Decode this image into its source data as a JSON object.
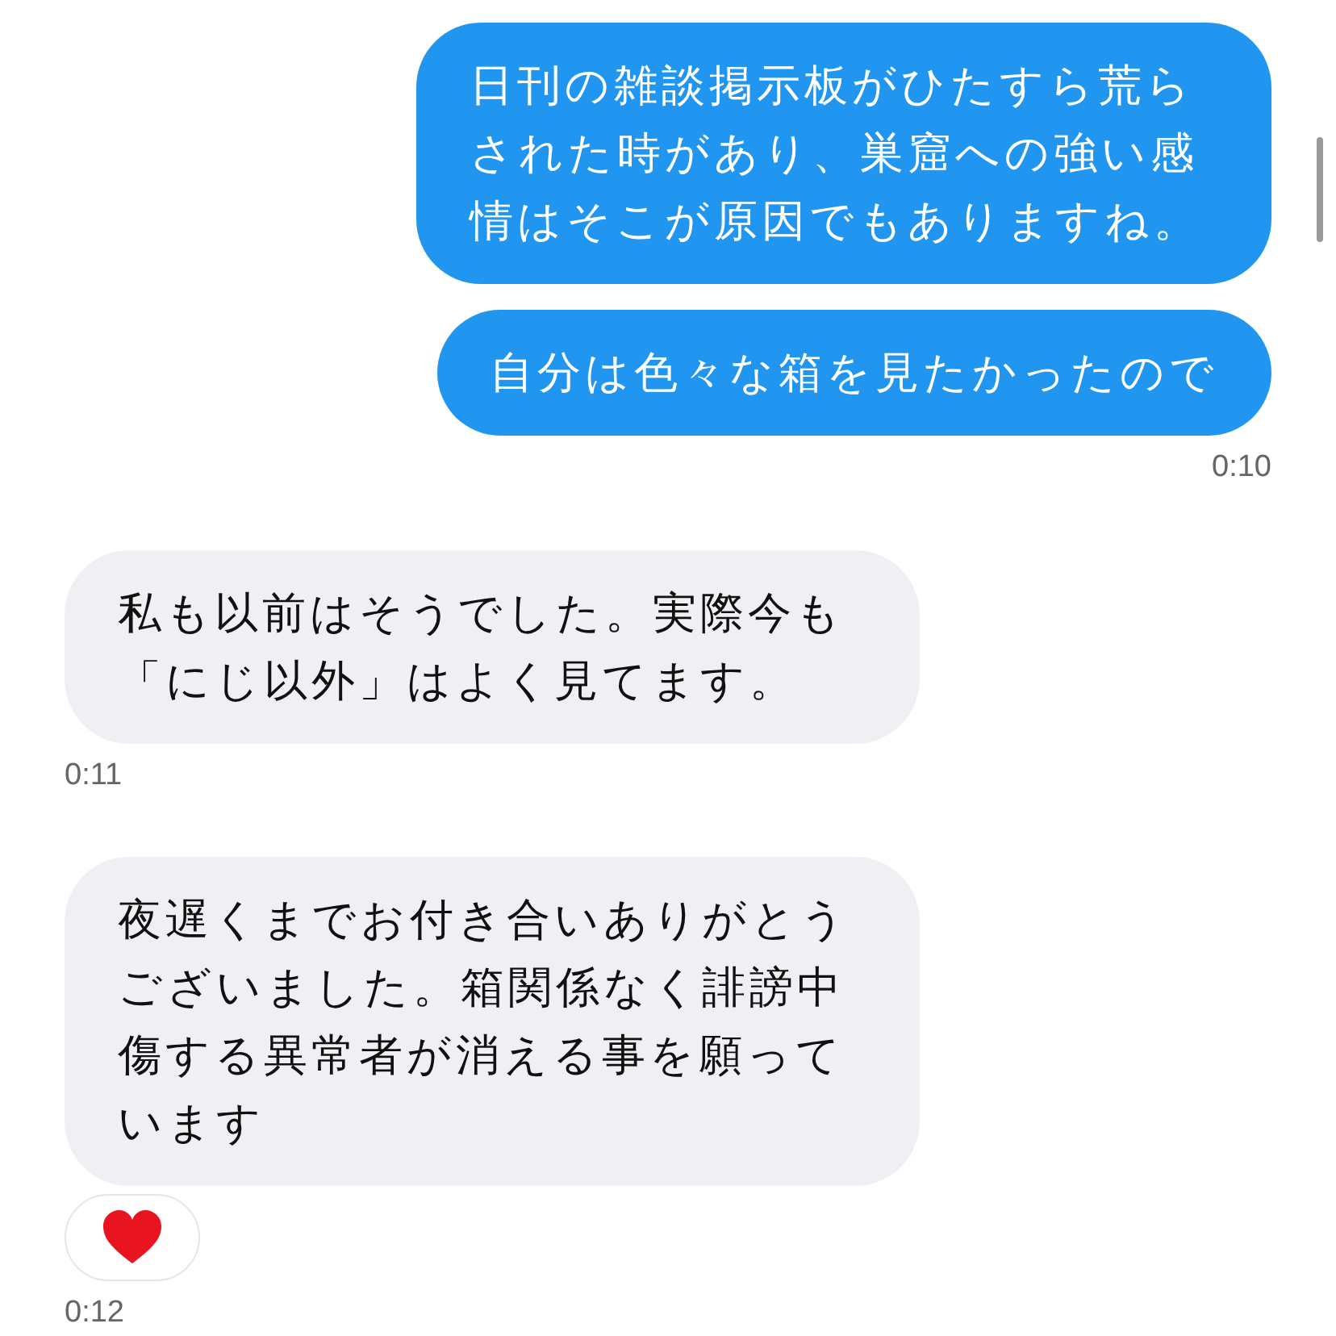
{
  "messages": [
    {
      "kind": "outgoing",
      "text": "日刊の雑談掲示板がひたすら荒らされた時があり、巣窟への強い感情はそこが原因でもありますね。",
      "reacted": false
    },
    {
      "kind": "outgoing",
      "text": "自分は色々な箱を見たかったので",
      "time": "0:10",
      "reacted": false
    },
    {
      "kind": "incoming",
      "text": "私も以前はそうでした。実際今も「にじ以外」はよく見てます。",
      "time": "0:11",
      "reacted": false
    },
    {
      "kind": "incoming",
      "text": "夜遅くまでお付き合いありがとうございました。箱関係なく誹謗中傷する異常者が消える事を願っています",
      "time": "0:12",
      "reacted": true
    }
  ]
}
